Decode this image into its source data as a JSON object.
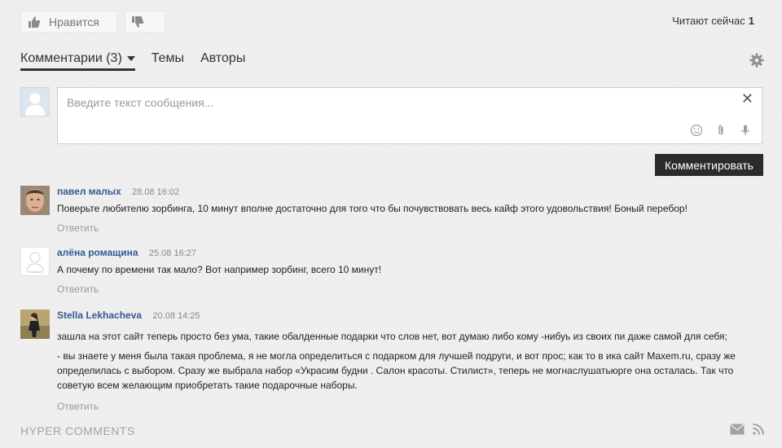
{
  "toolbar": {
    "like_label": "Нравится",
    "reading_label": "Читают сейчас",
    "reading_count": "1"
  },
  "tabs": [
    {
      "label": "Комментарии (3)",
      "active": true
    },
    {
      "label": "Темы",
      "active": false
    },
    {
      "label": "Авторы",
      "active": false
    }
  ],
  "composer": {
    "placeholder": "Введите текст сообщения...",
    "submit_label": "Комментировать"
  },
  "comments": [
    {
      "author": "павел малых",
      "date": "28.08 16:02",
      "paragraphs": [
        "Поверьте любителю зорбинга, 10 минут вполне достаточно для того что бы почувствовать весь кайф этого удовольствия! Боный перебор!"
      ],
      "reply_label": "Ответить",
      "avatar": "photo-man"
    },
    {
      "author": "алёна ромащина",
      "date": "25.08 16:27",
      "paragraphs": [
        "А почему по времени так мало? Вот например зорбинг, всего 10 минут!"
      ],
      "reply_label": "Ответить",
      "avatar": "no-photo"
    },
    {
      "author": "Stella Lekhacheva",
      "date": "20.08 14:25",
      "paragraphs": [
        "зашла на этот сайт теперь просто без ума, такие обалденные подарки что слов нет, вот думаю либо кому -нибуь из своих пи даже самой для себя;",
        "- вы знаете у меня была такая проблема, я не могла определиться с подарком для лучшей подруги, и вот прос; как то в ика сайт Maxem.ru, сразу же определилась с выбором. Сразу же выбрала набор «Украсим будни . Салон красоты. Стилист», теперь не могнаслушатьюрге она осталась. Так что советую всем желающим приобретать такие подарочные наборы."
      ],
      "reply_label": "Ответить",
      "avatar": "photo-woman"
    }
  ],
  "footer": {
    "logo": "HYPER COMMENTS",
    "icons": [
      "envelope-icon",
      "rss-icon"
    ]
  },
  "colors": {
    "author": "#335a95",
    "submit_bg": "#2b2b2b",
    "background": "#ededed"
  }
}
